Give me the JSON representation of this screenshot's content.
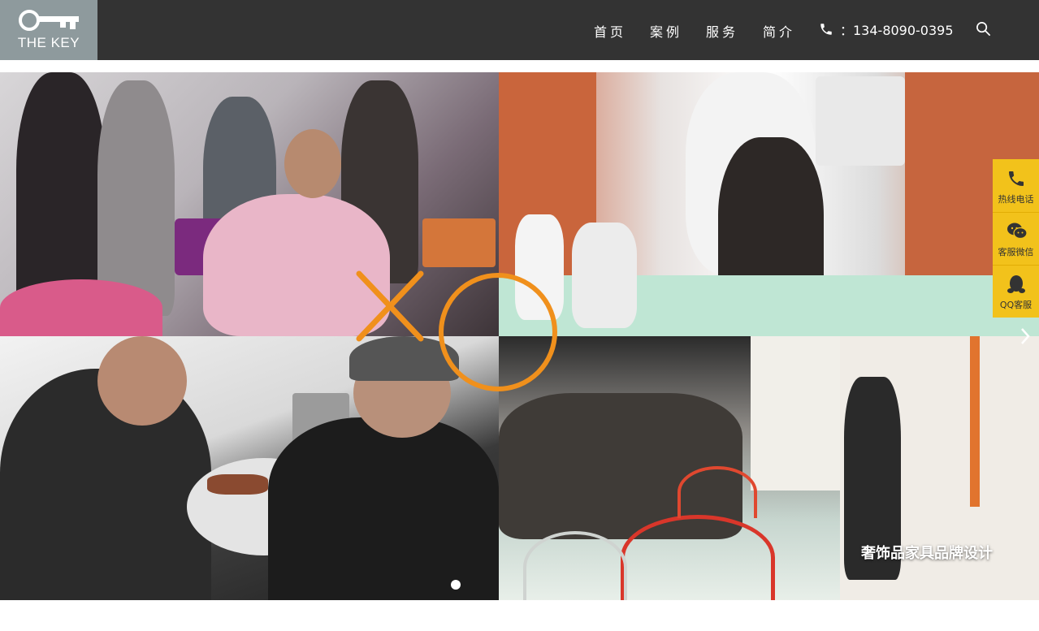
{
  "header": {
    "logo_text": "THE KEY",
    "nav": [
      "首页",
      "案例",
      "服务",
      "简介"
    ],
    "phone": "：134-8090-0395"
  },
  "banner": {
    "caption": "奢饰品家具品牌设计",
    "active_slide": 1,
    "slide_count": 1
  },
  "sidebar": {
    "items": [
      "热线电话",
      "客服微信",
      "QQ客服"
    ]
  },
  "colors": {
    "header_bg": "#333333",
    "logo_bg": "#8e9a9d",
    "accent_orange": "#f0901c",
    "sidebar_yellow": "#f2c21b"
  },
  "icons": [
    "key-icon",
    "phone-icon",
    "search-icon",
    "chevron-right-icon",
    "wechat-icon",
    "qq-icon"
  ]
}
